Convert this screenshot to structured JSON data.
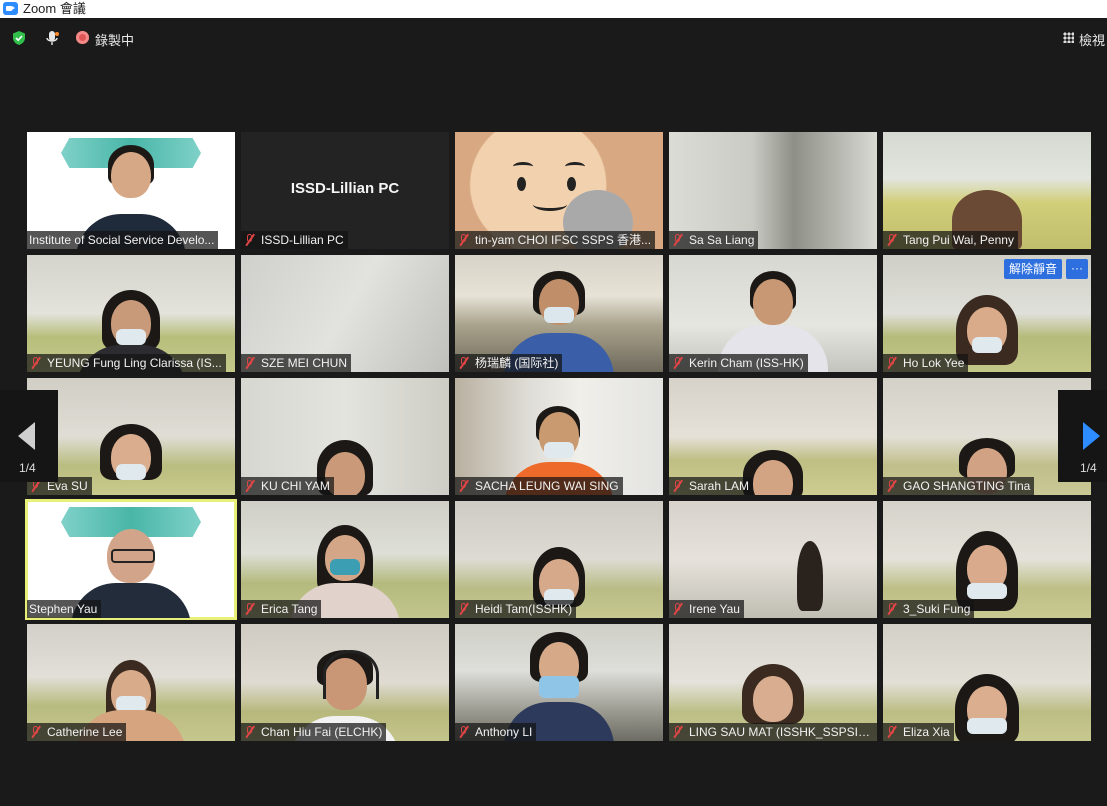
{
  "window": {
    "title": "Zoom 會議"
  },
  "toolbar": {
    "recording_label": "錄製中",
    "view_label": "檢視"
  },
  "tiles": [
    {
      "name": "Institute of Social Service Develo...",
      "muted": false
    },
    {
      "name": "ISSD-Lillian PC",
      "muted": true,
      "display_name": "ISSD-Lillian PC"
    },
    {
      "name": "tin-yam CHOI IFSC SSPS 香港...",
      "muted": true
    },
    {
      "name": "Sa Sa Liang",
      "muted": true
    },
    {
      "name": "Tang Pui Wai, Penny",
      "muted": true
    },
    {
      "name": "YEUNG Fung Ling Clarissa (IS...",
      "muted": true
    },
    {
      "name": "SZE MEI CHUN",
      "muted": true
    },
    {
      "name": "杨瑞麟 (国际社)",
      "muted": true
    },
    {
      "name": "Kerin Cham (ISS-HK)",
      "muted": true
    },
    {
      "name": "Ho Lok Yee",
      "muted": true
    },
    {
      "name": "Eva SU",
      "muted": true
    },
    {
      "name": "KU CHI YAM",
      "muted": true
    },
    {
      "name": "SACHA LEUNG WAI SING",
      "muted": true
    },
    {
      "name": "Sarah LAM",
      "muted": true
    },
    {
      "name": "GAO SHANGTING Tina",
      "muted": true
    },
    {
      "name": "Stephen Yau",
      "muted": false
    },
    {
      "name": "Erica Tang",
      "muted": true
    },
    {
      "name": "Heidi Tam(ISSHK)",
      "muted": true
    },
    {
      "name": "Irene Yau",
      "muted": true
    },
    {
      "name": "3_Suki Fung",
      "muted": true
    },
    {
      "name": "Catherine Lee",
      "muted": true
    },
    {
      "name": "Chan Hiu Fai (ELCHK)",
      "muted": true
    },
    {
      "name": "Anthony LI",
      "muted": true
    },
    {
      "name": "LING SAU MAT (ISSHK_SSPSIF...",
      "muted": true
    },
    {
      "name": "Eliza Xia",
      "muted": true
    }
  ],
  "hover_actions": {
    "unmute_label": "解除靜音",
    "more_label": "···"
  },
  "pagination": {
    "left": "1/4",
    "right": "1/4"
  },
  "colors": {
    "accent": "#2d8cff",
    "active_speaker": "#e8f07a",
    "mute": "#e04545"
  }
}
